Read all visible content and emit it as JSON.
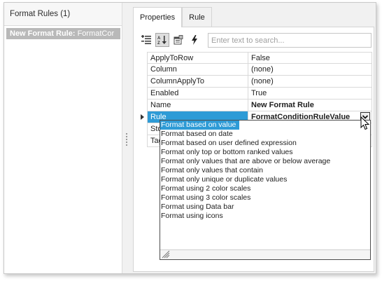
{
  "left_panel": {
    "header": "Format Rules (1)",
    "rule_item": {
      "bold_label": "New Format Rule:",
      "rest_label": " FormatCor"
    }
  },
  "tabs": [
    {
      "label": "Properties",
      "active": true
    },
    {
      "label": "Rule",
      "active": false
    }
  ],
  "toolbar": {
    "buttons": [
      "categorized-icon",
      "alphabetical-icon",
      "property-pages-icon",
      "events-icon"
    ],
    "search_placeholder": "Enter text to search..."
  },
  "properties": [
    {
      "name": "ApplyToRow",
      "value": "False",
      "bold": false
    },
    {
      "name": "Column",
      "value": "(none)",
      "bold": false
    },
    {
      "name": "ColumnApplyTo",
      "value": "(none)",
      "bold": false
    },
    {
      "name": "Enabled",
      "value": "True",
      "bold": false
    },
    {
      "name": "Name",
      "value": "New Format Rule",
      "bold": true
    },
    {
      "name": "Rule",
      "value": "FormatConditionRuleValue",
      "bold": true,
      "selected": true
    },
    {
      "name": "Sto",
      "value": "",
      "bold": false
    },
    {
      "name": "Tag",
      "value": "",
      "bold": false
    }
  ],
  "dropdown": {
    "items": [
      "Format based on value",
      "Format based on date",
      "Format based on user defined expression",
      "Format only top or bottom ranked values",
      "Format only values that are above or below average",
      "Format only values that contain",
      "Format only unique or duplicate values",
      "Format using 2 color scales",
      "Format using 3 color scales",
      "Format using Data bar",
      "Format using icons"
    ],
    "selected_index": 0
  },
  "colors": {
    "selection": "#2e9bd6",
    "left_selected_item": "#b9b9b9"
  }
}
